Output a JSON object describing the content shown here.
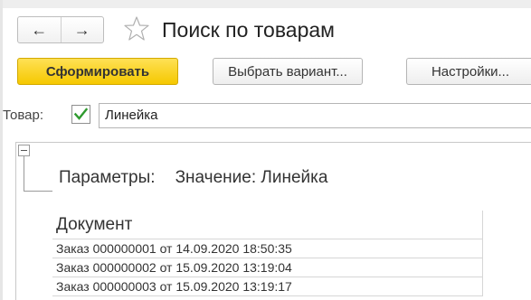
{
  "header": {
    "back_glyph": "←",
    "forward_glyph": "→",
    "title": "Поиск по товарам",
    "favorite_icon": "star-outline-icon"
  },
  "toolbar": {
    "generate_label": "Сформировать",
    "choose_variant_label": "Выбрать вариант...",
    "settings_label": "Настройки..."
  },
  "filter": {
    "label": "Товар:",
    "checked": true,
    "value": "Линейка"
  },
  "report": {
    "params_label": "Параметры:",
    "params_value": "Значение: Линейка",
    "column_header": "Документ",
    "rows": [
      "Заказ 000000001 от 14.09.2020 18:50:35",
      "Заказ 000000002 от 15.09.2020 13:19:04",
      "Заказ 000000003 от 15.09.2020 13:19:17"
    ]
  },
  "colors": {
    "primary_button": "#f5c800",
    "checkmark": "#2e9a2e"
  }
}
